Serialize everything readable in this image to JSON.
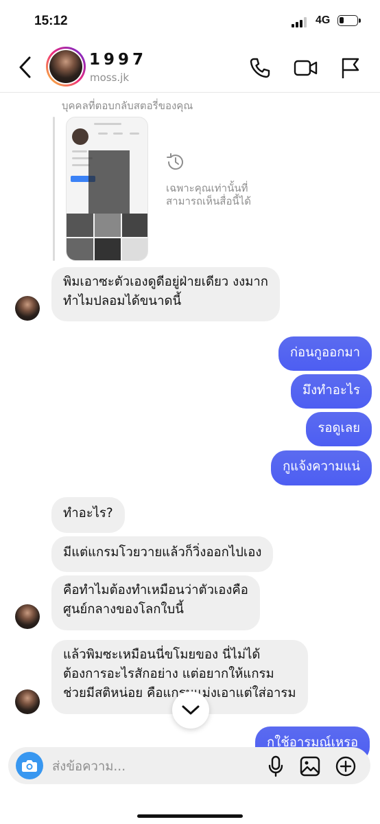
{
  "status_bar": {
    "time": "15:12",
    "network": "4G"
  },
  "header": {
    "display_name": "1997",
    "username": "moss.jk"
  },
  "story_reply": {
    "label": "บุคคลที่ตอบกลับสตอรี่ของคุณ",
    "expired_text": "เฉพาะคุณเท่านั้นที่สามารถเห็นสื่อนี้ได้"
  },
  "messages": [
    {
      "side": "in",
      "lines": [
        "พิมเอาซะตัวเองดูดีอยู่ฝ่ายเดียว งงมาก",
        "ทำไมปลอมได้ขนาดนี้"
      ]
    },
    {
      "side": "out",
      "lines": [
        "ก่อนกูออกมา"
      ]
    },
    {
      "side": "out",
      "lines": [
        "มึงทำอะไร"
      ]
    },
    {
      "side": "out",
      "lines": [
        "รอดูเลย"
      ]
    },
    {
      "side": "out",
      "lines": [
        "กูแจ้งความแน่"
      ]
    },
    {
      "side": "in",
      "lines": [
        "ทำอะไร?"
      ]
    },
    {
      "side": "in",
      "lines": [
        "มีแต่แกรมโวยวายแล้วก็วิ่งออกไปเอง"
      ]
    },
    {
      "side": "in",
      "lines": [
        "คือทำไมต้องทำเหมือนว่าตัวเองคือ",
        "ศูนย์กลางของโลกใบนี้"
      ]
    },
    {
      "side": "in",
      "lines": [
        "แล้วพิมซะเหมือนนี่ขโมยของ นี่ไม่ได้",
        "ต้องการอะไรสักอย่าง แต่อยากให้แกรม",
        "ช่วยมีสติหน่อย คือแกรมแม่งเอาแต่ใส่อารม"
      ]
    },
    {
      "side": "out",
      "lines": [
        "กูใช้อารมณ์เหรอ"
      ]
    }
  ],
  "composer": {
    "placeholder": "ส่งข้อความ..."
  },
  "colors": {
    "outgoing_bubble": "#4d5ef2",
    "incoming_bubble": "#efefef",
    "camera_button": "#3897f0"
  }
}
